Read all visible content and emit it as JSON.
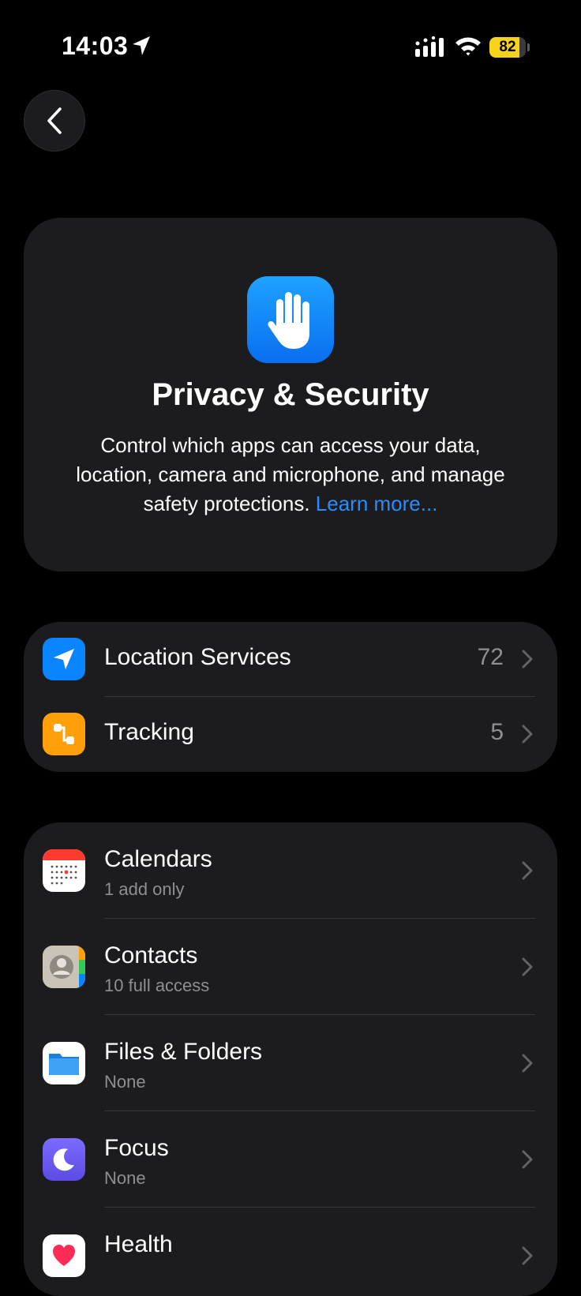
{
  "status_bar": {
    "time": "14:03",
    "battery_label": "82",
    "battery_level": 0.82,
    "battery_color": "#f7d21b"
  },
  "header": {
    "back_icon": "chevron-left-icon"
  },
  "hero": {
    "icon": "raised-hand-icon",
    "title": "Privacy & Security",
    "description": "Control which apps can access your data, location, camera and microphone, and manage safety protections.",
    "link": "Learn more..."
  },
  "group1": [
    {
      "label": "Location Services",
      "value": "72",
      "icon": "location-arrow-icon",
      "icon_color": "#0a84ff"
    },
    {
      "label": "Tracking",
      "value": "5",
      "icon": "tracking-icon",
      "icon_color": "#ff9f0a"
    }
  ],
  "group2": [
    {
      "label": "Calendars",
      "sub": "1 add only",
      "icon": "calendar-icon"
    },
    {
      "label": "Contacts",
      "sub": "10 full access",
      "icon": "contacts-icon"
    },
    {
      "label": "Files & Folders",
      "sub": "None",
      "icon": "folder-icon"
    },
    {
      "label": "Focus",
      "sub": "None",
      "icon": "moon-icon"
    },
    {
      "label": "Health",
      "icon": "heart-icon"
    }
  ],
  "colors": {
    "accent_link": "#2a8cff",
    "card_background": "#1c1c1e",
    "secondary_text": "#8e8e93"
  }
}
